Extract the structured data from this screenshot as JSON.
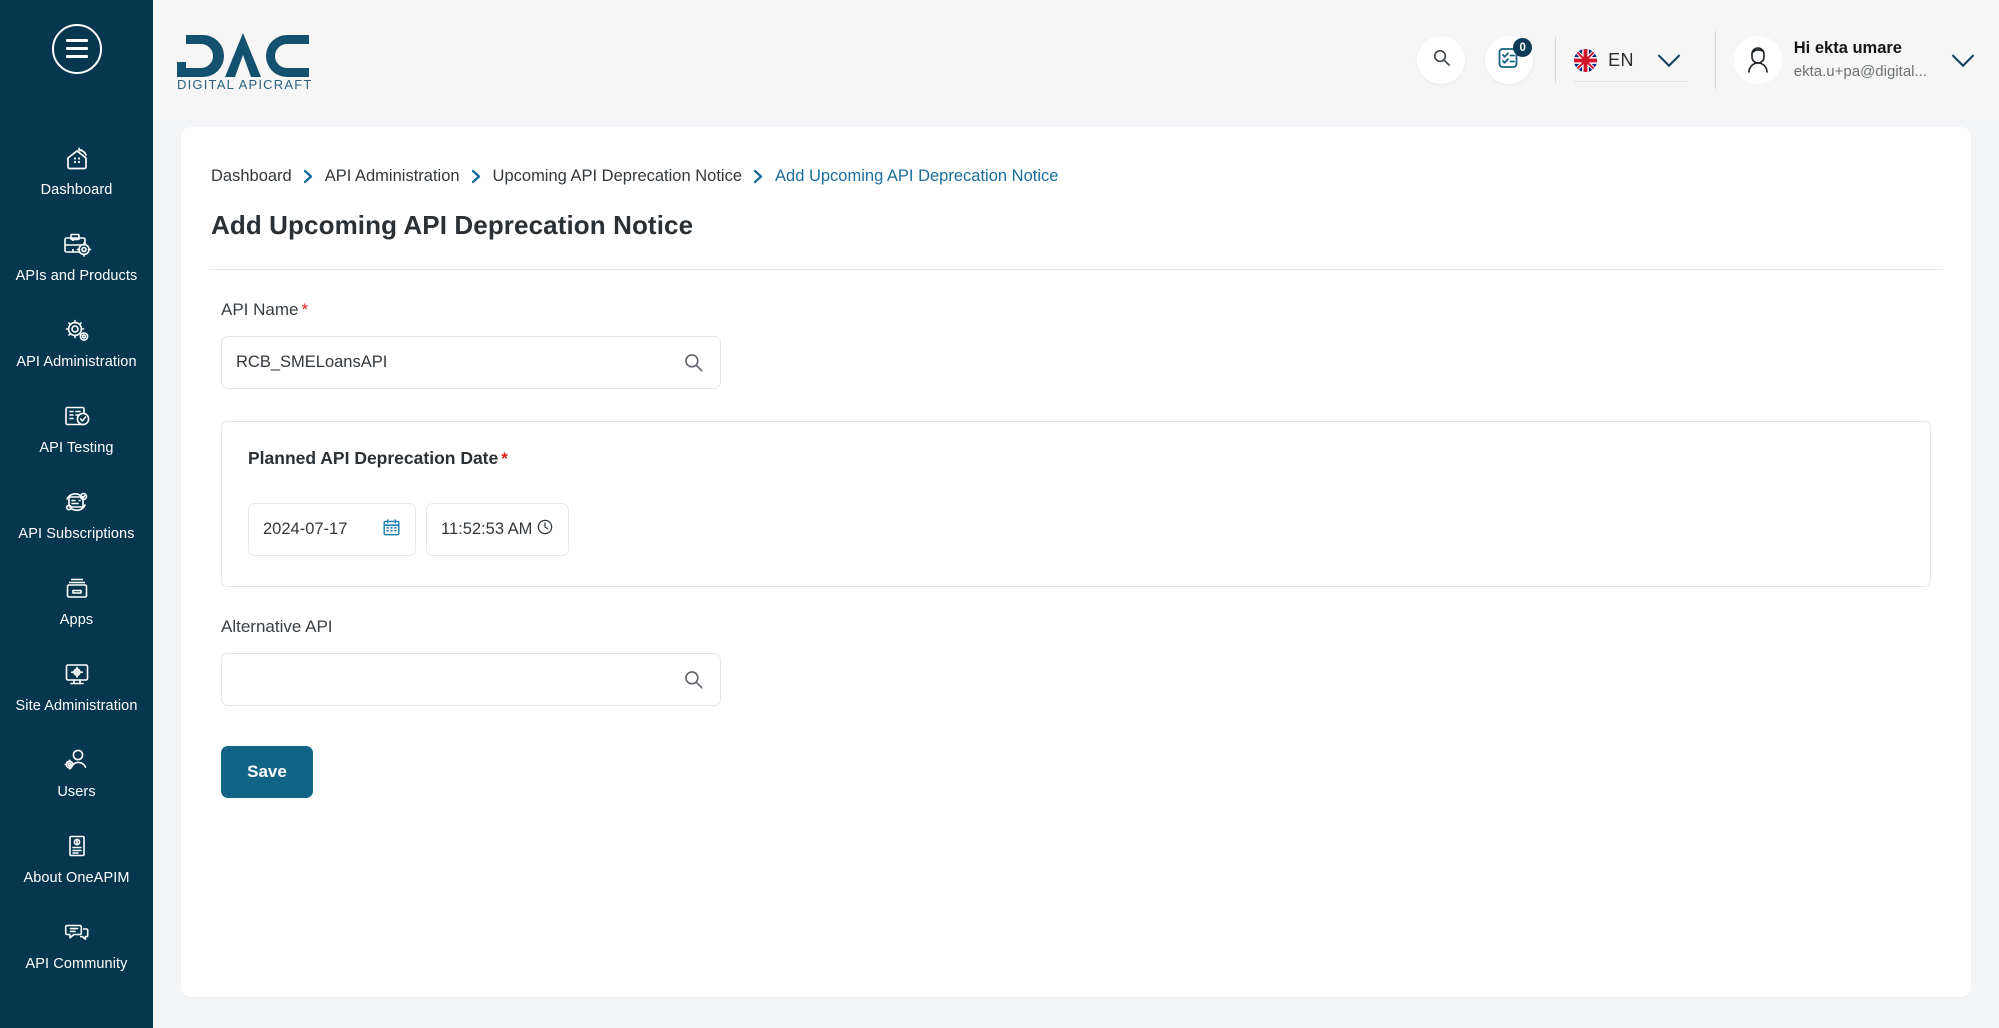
{
  "sidebar": {
    "menu_toggle": "menu-toggle",
    "items": [
      {
        "label": "Dashboard",
        "icon": "dashboard-icon"
      },
      {
        "label": "APIs and Products",
        "icon": "apis-products-icon"
      },
      {
        "label": "API Administration",
        "icon": "api-administration-icon"
      },
      {
        "label": "API Testing",
        "icon": "api-testing-icon"
      },
      {
        "label": "API Subscriptions",
        "icon": "api-subscriptions-icon"
      },
      {
        "label": "Apps",
        "icon": "apps-icon"
      },
      {
        "label": "Site Administration",
        "icon": "site-administration-icon"
      },
      {
        "label": "Users",
        "icon": "users-icon"
      },
      {
        "label": "About OneAPIM",
        "icon": "about-icon"
      },
      {
        "label": "API Community",
        "icon": "community-icon"
      }
    ]
  },
  "header": {
    "logo_title": "DAC",
    "logo_subtitle": "DIGITAL APICRAFT",
    "search_icon": "search-icon",
    "tasks_icon": "tasks-icon",
    "tasks_badge": "0",
    "language": {
      "code": "EN",
      "flag": "uk-flag-icon"
    },
    "user": {
      "name": "Hi ekta umare",
      "email": "ekta.u+pa@digital...",
      "avatar": "user-avatar-icon"
    }
  },
  "breadcrumb": [
    {
      "label": "Dashboard",
      "active": false
    },
    {
      "label": "API Administration",
      "active": false
    },
    {
      "label": "Upcoming API Deprecation Notice",
      "active": false
    },
    {
      "label": "Add Upcoming API Deprecation Notice",
      "active": true
    }
  ],
  "page": {
    "title": "Add Upcoming API Deprecation Notice"
  },
  "form": {
    "api_name": {
      "label": "API Name",
      "required_marker": "*",
      "value": "RCB_SMELoansAPI",
      "placeholder": ""
    },
    "deprecation": {
      "legend": "Planned API Deprecation Date",
      "required_marker": "*",
      "date_value": "2024-07-17",
      "time_value": "11:52:53 AM",
      "calendar_icon": "calendar-icon",
      "clock_icon": "clock-icon"
    },
    "alternative_api": {
      "label": "Alternative API",
      "value": "",
      "placeholder": ""
    },
    "save_label": "Save"
  },
  "colors": {
    "sidebar_bg": "#06374f",
    "accent": "#116485",
    "breadcrumb_active": "#1b6d9c",
    "required": "#e01b1b",
    "page_bg": "#f4f5f6"
  }
}
